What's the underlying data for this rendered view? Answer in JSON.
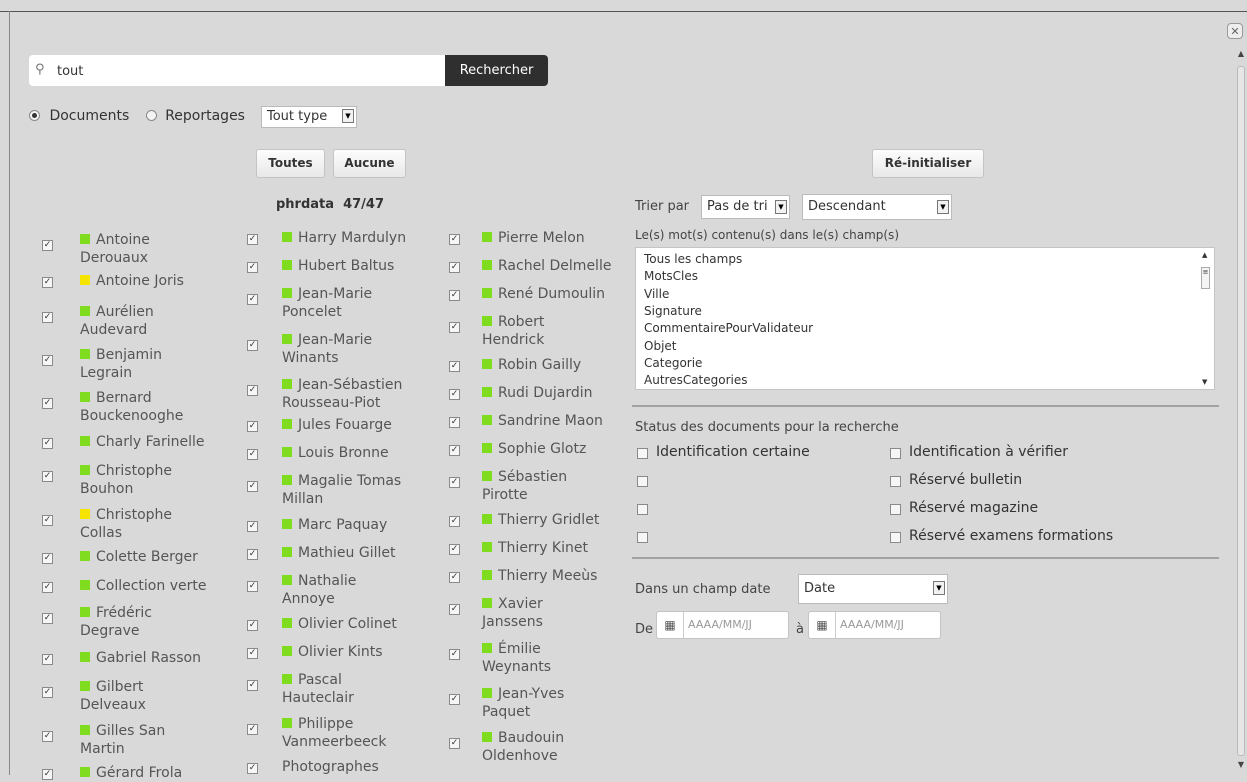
{
  "search": {
    "value": "tout",
    "button": "Rechercher"
  },
  "scope": {
    "documents": "Documents",
    "reportages": "Reportages",
    "type": "Tout type"
  },
  "buttons": {
    "toutes": "Toutes",
    "aucune": "Aucune",
    "reinit": "Ré-initialiser"
  },
  "phr": {
    "title": "phrdata  47/47"
  },
  "col1": [
    {
      "l1": "Antoine",
      "l2": "Derouaux",
      "color": "#7fdc1f"
    },
    {
      "l1": "Antoine Joris",
      "l2": "",
      "color": "#f4e400"
    },
    {
      "l1": "Aurélien",
      "l2": "Audevard",
      "color": "#7fdc1f"
    },
    {
      "l1": "Benjamin",
      "l2": "Legrain",
      "color": "#7fdc1f"
    },
    {
      "l1": "Bernard",
      "l2": "Bouckenooghe",
      "color": "#7fdc1f"
    },
    {
      "l1": "Charly Farinelle",
      "l2": "",
      "color": "#7fdc1f"
    },
    {
      "l1": "Christophe",
      "l2": "Bouhon",
      "color": "#7fdc1f"
    },
    {
      "l1": "Christophe",
      "l2": "Collas",
      "color": "#f4e400"
    },
    {
      "l1": "Colette Berger",
      "l2": "",
      "color": "#7fdc1f"
    },
    {
      "l1": "Collection verte",
      "l2": "",
      "color": "#7fdc1f"
    },
    {
      "l1": "Frédéric",
      "l2": "Degrave",
      "color": "#7fdc1f"
    },
    {
      "l1": "Gabriel Rasson",
      "l2": "",
      "color": "#7fdc1f"
    },
    {
      "l1": "Gilbert",
      "l2": "Delveaux",
      "color": "#7fdc1f"
    },
    {
      "l1": "Gilles San",
      "l2": "Martin",
      "color": "#7fdc1f"
    },
    {
      "l1": "Gérard Frola",
      "l2": "",
      "color": "#7fdc1f"
    }
  ],
  "col2": [
    {
      "l1": "Harry Mardulyn",
      "l2": "",
      "color": "#7fdc1f"
    },
    {
      "l1": "Hubert Baltus",
      "l2": "",
      "color": "#7fdc1f"
    },
    {
      "l1": "Jean-Marie",
      "l2": "Poncelet",
      "color": "#7fdc1f"
    },
    {
      "l1": "Jean-Marie",
      "l2": "Winants",
      "color": "#7fdc1f"
    },
    {
      "l1": "Jean-Sébastien",
      "l2": "Rousseau-Piot",
      "color": "#7fdc1f"
    },
    {
      "l1": "Jules Fouarge",
      "l2": "",
      "color": "#7fdc1f"
    },
    {
      "l1": "Louis Bronne",
      "l2": "",
      "color": "#7fdc1f"
    },
    {
      "l1": "Magalie Tomas",
      "l2": "Millan",
      "color": "#7fdc1f"
    },
    {
      "l1": "Marc Paquay",
      "l2": "",
      "color": "#7fdc1f"
    },
    {
      "l1": "Mathieu Gillet",
      "l2": "",
      "color": "#7fdc1f"
    },
    {
      "l1": "Nathalie",
      "l2": "Annoye",
      "color": "#7fdc1f"
    },
    {
      "l1": "Olivier Colinet",
      "l2": "",
      "color": "#7fdc1f"
    },
    {
      "l1": "Olivier Kints",
      "l2": "",
      "color": "#7fdc1f"
    },
    {
      "l1": "Pascal",
      "l2": "Hauteclair",
      "color": "#7fdc1f"
    },
    {
      "l1": "Philippe",
      "l2": "Vanmeerbeeck",
      "color": "#7fdc1f"
    },
    {
      "l1": "Photographes",
      "l2": "",
      "color": ""
    }
  ],
  "col3": [
    {
      "l1": "Pierre Melon",
      "l2": "",
      "color": "#7fdc1f"
    },
    {
      "l1": "Rachel Delmelle",
      "l2": "",
      "color": "#7fdc1f"
    },
    {
      "l1": "René Dumoulin",
      "l2": "",
      "color": "#7fdc1f"
    },
    {
      "l1": "Robert",
      "l2": "Hendrick",
      "color": "#7fdc1f"
    },
    {
      "l1": "Robin Gailly",
      "l2": "",
      "color": "#7fdc1f"
    },
    {
      "l1": "Rudi Dujardin",
      "l2": "",
      "color": "#7fdc1f"
    },
    {
      "l1": "Sandrine Maon",
      "l2": "",
      "color": "#7fdc1f"
    },
    {
      "l1": "Sophie Glotz",
      "l2": "",
      "color": "#7fdc1f"
    },
    {
      "l1": "Sébastien",
      "l2": "Pirotte",
      "color": "#7fdc1f"
    },
    {
      "l1": "Thierry Gridlet",
      "l2": "",
      "color": "#7fdc1f"
    },
    {
      "l1": "Thierry Kinet",
      "l2": "",
      "color": "#7fdc1f"
    },
    {
      "l1": "Thierry Meeùs",
      "l2": "",
      "color": "#7fdc1f"
    },
    {
      "l1": "Xavier",
      "l2": "Janssens",
      "color": "#7fdc1f"
    },
    {
      "l1": "Émilie",
      "l2": "Weynants",
      "color": "#7fdc1f"
    },
    {
      "l1": "Jean-Yves",
      "l2": "Paquet",
      "color": "#7fdc1f"
    },
    {
      "l1": "Baudouin",
      "l2": "Oldenhove",
      "color": "#7fdc1f"
    }
  ],
  "sort": {
    "label": "Trier par",
    "field": "Pas de tri",
    "order": "Descendant"
  },
  "fields": {
    "label": "Le(s) mot(s) contenu(s) dans le(s) champ(s)",
    "options": [
      "Tous les champs",
      "MotsCles",
      "Ville",
      "Signature",
      "CommentairePourValidateur",
      "Objet",
      "Categorie",
      "AutresCategories"
    ]
  },
  "status": {
    "label": "Status des documents pour la recherche",
    "left": [
      "Identification certaine",
      "",
      "",
      ""
    ],
    "right": [
      "Identification à vérifier",
      "Réservé bulletin",
      "Réservé magazine",
      "Réservé examens formations"
    ]
  },
  "date": {
    "label": "Dans un champ date",
    "field": "Date",
    "from": "De",
    "to": "à",
    "placeholder": "AAAA/MM/JJ"
  }
}
